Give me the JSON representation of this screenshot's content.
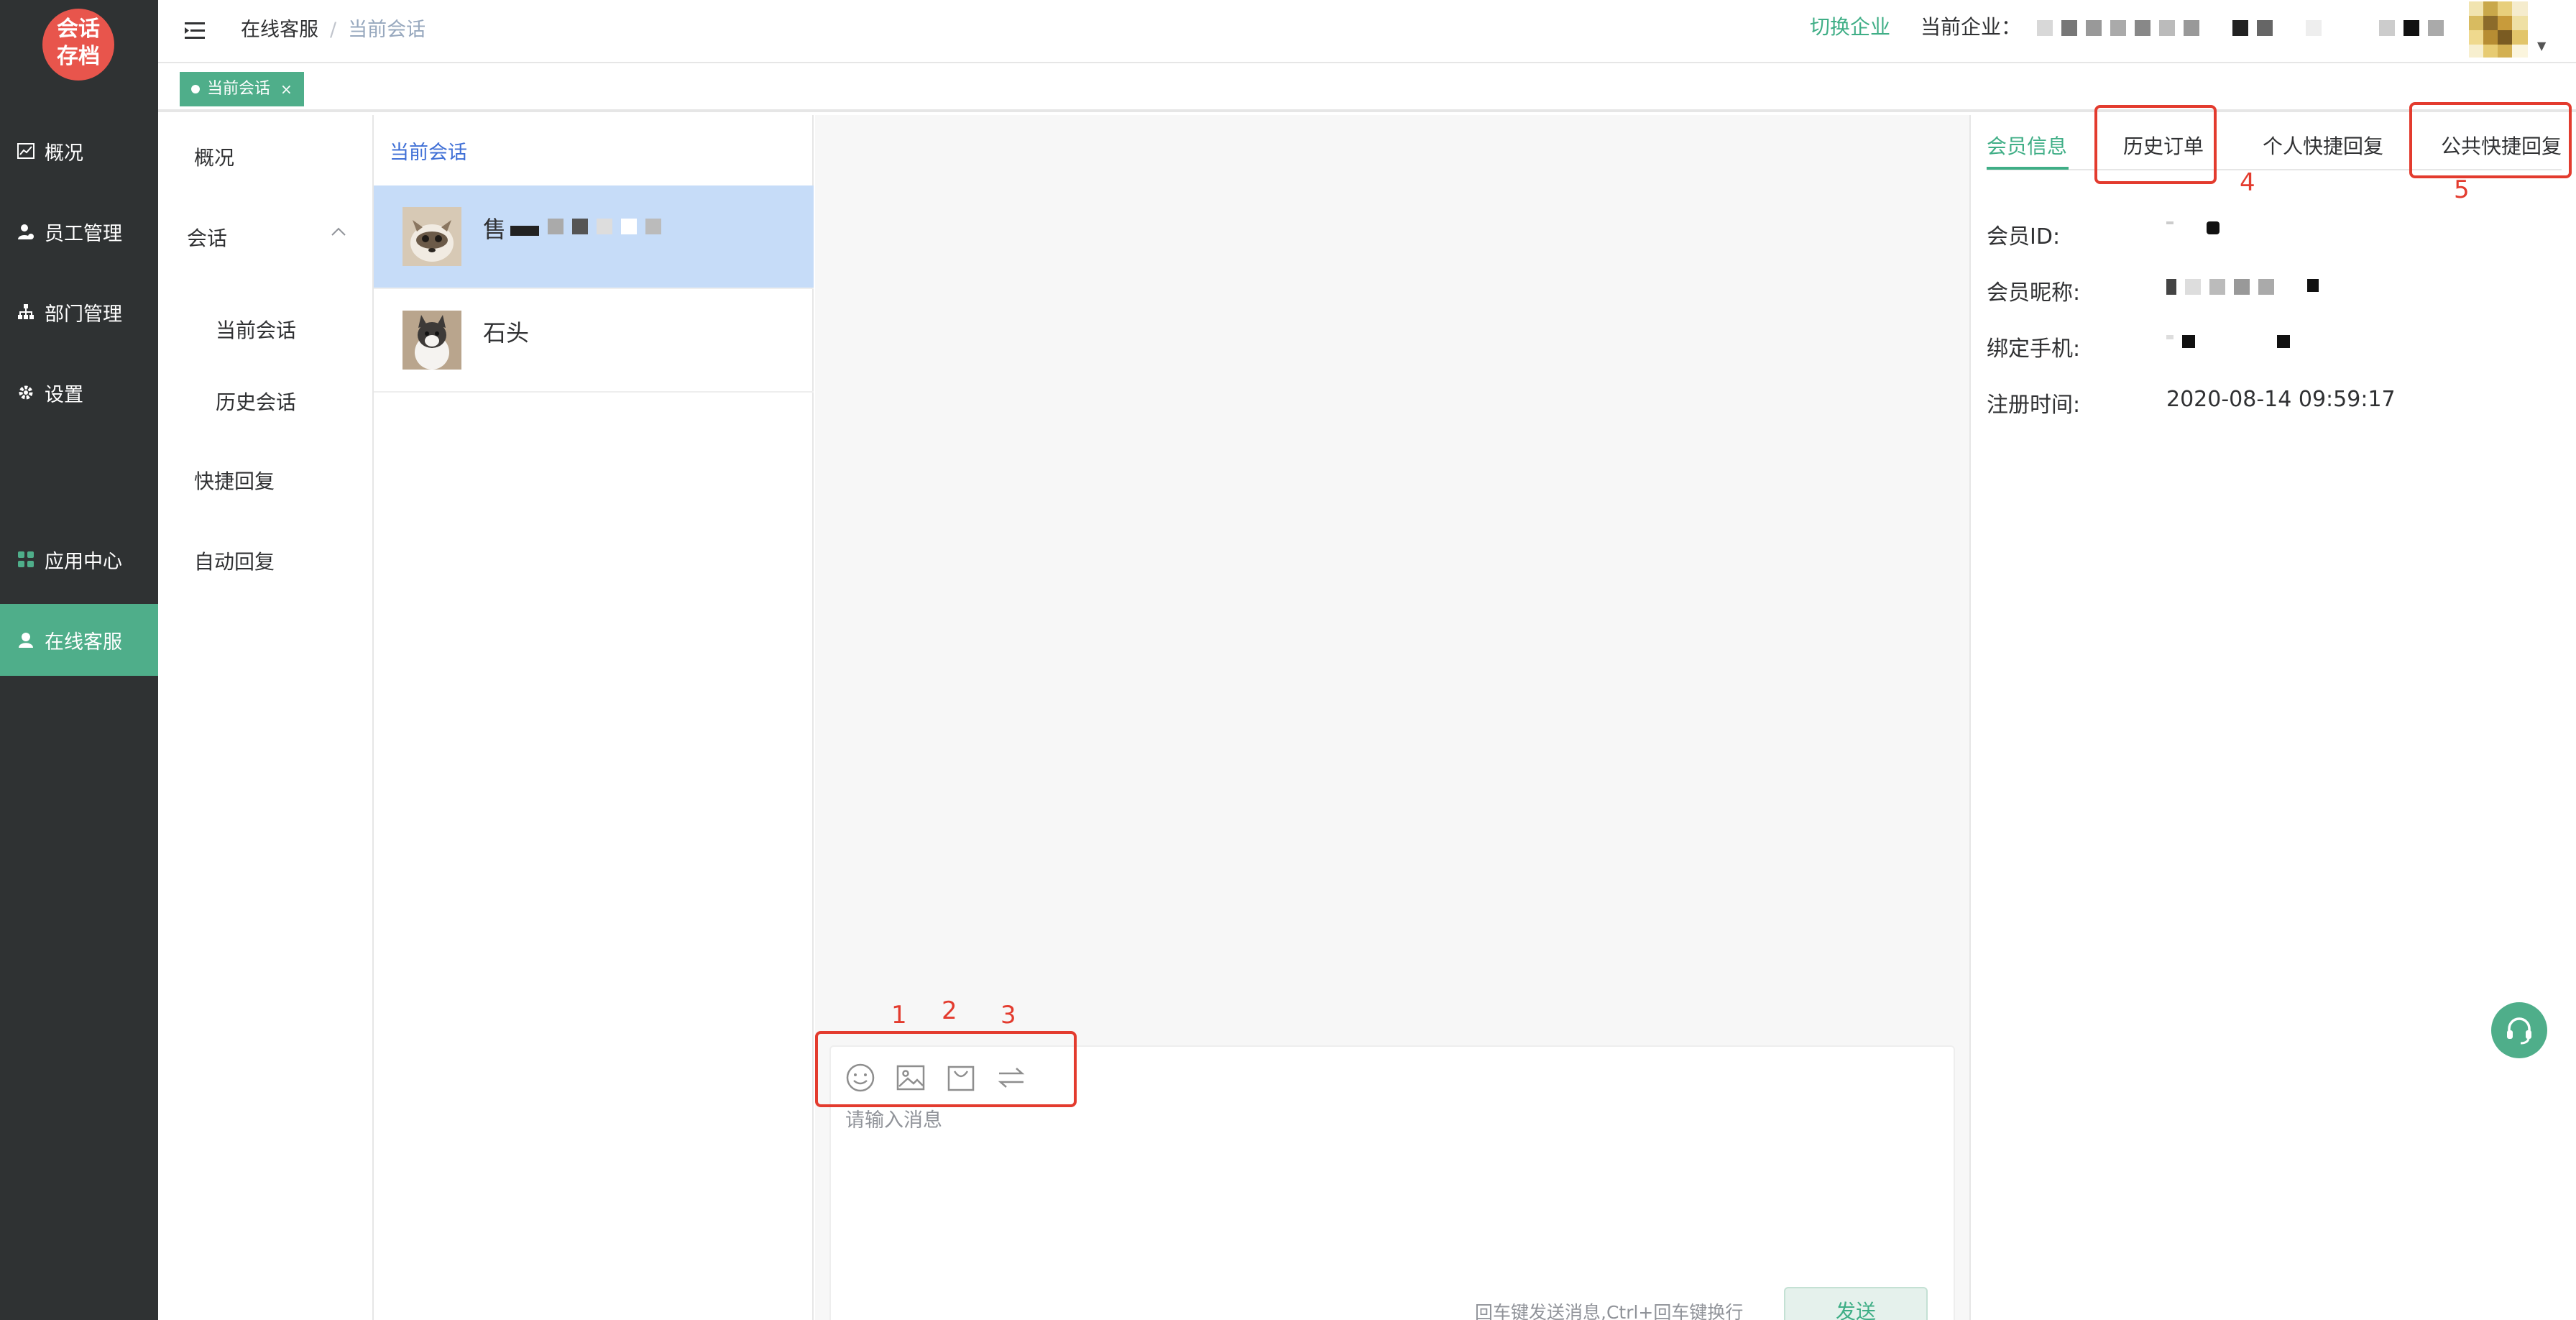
{
  "logo": {
    "line1": "会话",
    "line2": "存档"
  },
  "nav": {
    "items": [
      {
        "label": "概况",
        "icon": "chart-icon"
      },
      {
        "label": "员工管理",
        "icon": "user-icon"
      },
      {
        "label": "部门管理",
        "icon": "org-icon"
      },
      {
        "label": "设置",
        "icon": "gear-icon"
      },
      {
        "label": "应用中心",
        "icon": "apps-icon"
      },
      {
        "label": "在线客服",
        "icon": "support-icon",
        "active": true
      }
    ]
  },
  "header": {
    "breadcrumb": [
      "在线客服",
      "当前会话"
    ],
    "switch_enterprise": "切换企业",
    "current_enterprise_label": "当前企业："
  },
  "tags": [
    {
      "label": "当前会话",
      "close": "×"
    }
  ],
  "submenu": {
    "overview": "概况",
    "session": "会话",
    "current_session": "当前会话",
    "history_session": "历史会话",
    "quick_reply": "快捷回复",
    "auto_reply": "自动回复"
  },
  "sessions": {
    "title": "当前会话",
    "list": [
      {
        "name": "售"
      },
      {
        "name": "石头"
      }
    ]
  },
  "composer": {
    "placeholder": "请输入消息",
    "hint": "回车键发送消息,Ctrl+回车键换行",
    "send": "发送",
    "annotations": [
      "1",
      "2",
      "3"
    ]
  },
  "right": {
    "tabs": [
      "会员信息",
      "历史订单",
      "个人快捷回复",
      "公共快捷回复"
    ],
    "annotations": [
      "4",
      "5"
    ],
    "fields": [
      {
        "label": "会员ID:",
        "value": ""
      },
      {
        "label": "会员昵称:",
        "value": ""
      },
      {
        "label": "绑定手机:",
        "value": ""
      },
      {
        "label": "注册时间:",
        "value": "2020-08-14 09:59:17"
      }
    ]
  },
  "colors": {
    "nav_bg": "#2f3233",
    "accent": "#4fae8a",
    "link_blue": "#3f6fd6",
    "annotation_red": "#e33b2e",
    "selected_row": "#c6dcf8"
  }
}
